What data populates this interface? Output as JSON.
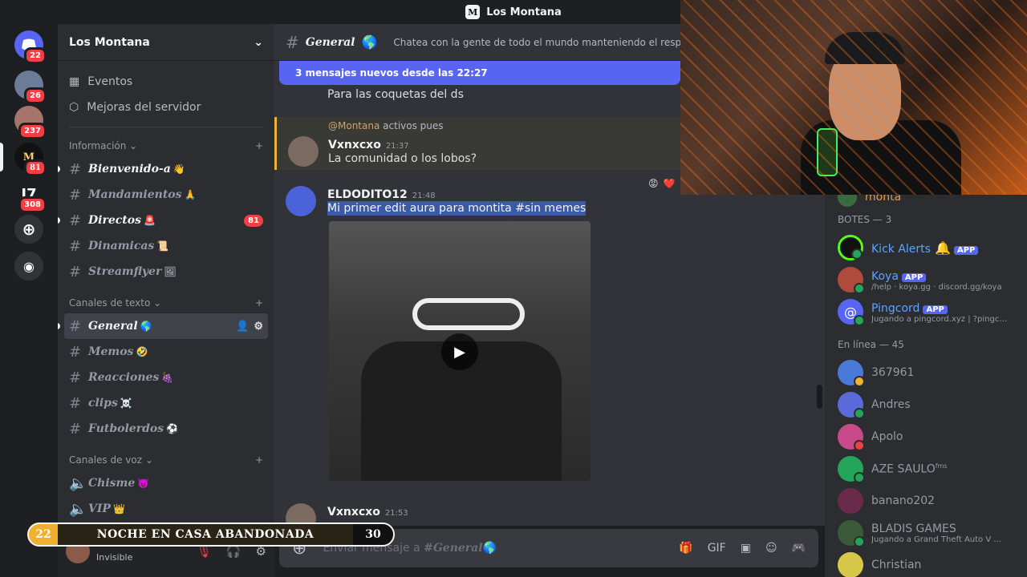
{
  "window": {
    "title": "Los Montana"
  },
  "rail": {
    "servers": [
      {
        "name": "discord-home",
        "badge": "22",
        "label": ""
      },
      {
        "name": "server-1",
        "badge": "26",
        "label": ""
      },
      {
        "name": "server-2",
        "badge": "237",
        "label": ""
      },
      {
        "name": "server-los-montana",
        "badge": "81",
        "label": "M"
      },
      {
        "name": "server-j7",
        "badge": "308",
        "label": "J7"
      }
    ]
  },
  "sidebar": {
    "server_name": "Los Montana",
    "links": [
      {
        "label": "Eventos"
      },
      {
        "label": "Mejoras del servidor"
      }
    ],
    "categories": [
      {
        "label": "Información",
        "channels": [
          {
            "label": "Bienvenido-a",
            "emoji": "👋"
          },
          {
            "label": "Mandamientos",
            "emoji": "🙏"
          },
          {
            "label": "Directos",
            "emoji": "🚨",
            "badge": "81"
          },
          {
            "label": "Dinamicas",
            "emoji": "📜"
          },
          {
            "label": "Streamflyer",
            "emoji": "🖼"
          }
        ]
      },
      {
        "label": "Canales de texto",
        "channels": [
          {
            "label": "General",
            "emoji": "🌎"
          },
          {
            "label": "Memos",
            "emoji": "🤣"
          },
          {
            "label": "Reacciones",
            "emoji": "🍇"
          },
          {
            "label": "clips",
            "emoji": "☠️"
          },
          {
            "label": "Futbolerdos",
            "emoji": "⚽"
          }
        ]
      },
      {
        "label": "Canales de voz",
        "channels": [
          {
            "label": "Chisme",
            "emoji": "😈"
          },
          {
            "label": "VIP",
            "emoji": "👑"
          }
        ]
      }
    ]
  },
  "user_panel": {
    "status": "Invisible"
  },
  "channel_header": {
    "name": "General",
    "emoji": "🌎",
    "topic": "Chatea con la gente de todo el mundo manteniendo el respeto."
  },
  "chat": {
    "new_messages_bar": "3 mensajes nuevos desde las 22:27",
    "messages": [
      {
        "text": "Para las coquetas del ds"
      },
      {
        "reply_mention": "@Montana",
        "reply_text": "activos pues",
        "author": "Vxnxcxo",
        "time": "21:37",
        "text": "La comunidad o los lobos?"
      },
      {
        "author": "ELDODITO12",
        "time": "21:48",
        "text": "Mi primer edit aura para montita #sin memes"
      },
      {
        "author": "Vxnxcxo",
        "time": "21:53"
      }
    ]
  },
  "composer": {
    "placeholder_prefix": "Enviar mensaje a ",
    "placeholder_channel": "#General",
    "placeholder_emoji": "🌎"
  },
  "members": {
    "partial_top": "monta",
    "bots_header": "BOTES — 3",
    "bots": [
      {
        "name": "Kick Alerts",
        "emoji": "🔔",
        "tag": "APP",
        "sub": ""
      },
      {
        "name": "Koya",
        "emoji": "",
        "tag": "APP",
        "sub": "/help · koya.gg · discord.gg/koya"
      },
      {
        "name": "Pingcord",
        "emoji": "",
        "tag": "APP",
        "sub": "Jugando a pingcord.xyz | ?pingcor..."
      }
    ],
    "online_header": "En línea — 45",
    "online": [
      {
        "name": "367961",
        "sub": ""
      },
      {
        "name": "Andres",
        "sub": ""
      },
      {
        "name": "Apolo",
        "sub": ""
      },
      {
        "name": "AZE SAULO",
        "suffix": "fms",
        "sub": ""
      },
      {
        "name": "banano202",
        "sub": ""
      },
      {
        "name": "BLADIS GAMES",
        "sub": "Jugando a Grand Theft Auto V ..."
      },
      {
        "name": "Christian",
        "sub": ""
      }
    ]
  },
  "overlay": {
    "left_num": "22",
    "title": "NOCHE EN CASA ABANDONADA",
    "right_num": "30"
  },
  "colors": {
    "blurple": "#5865f2",
    "red_badge": "#f23f43",
    "online": "#23a55a",
    "banner": "#f0b030"
  }
}
